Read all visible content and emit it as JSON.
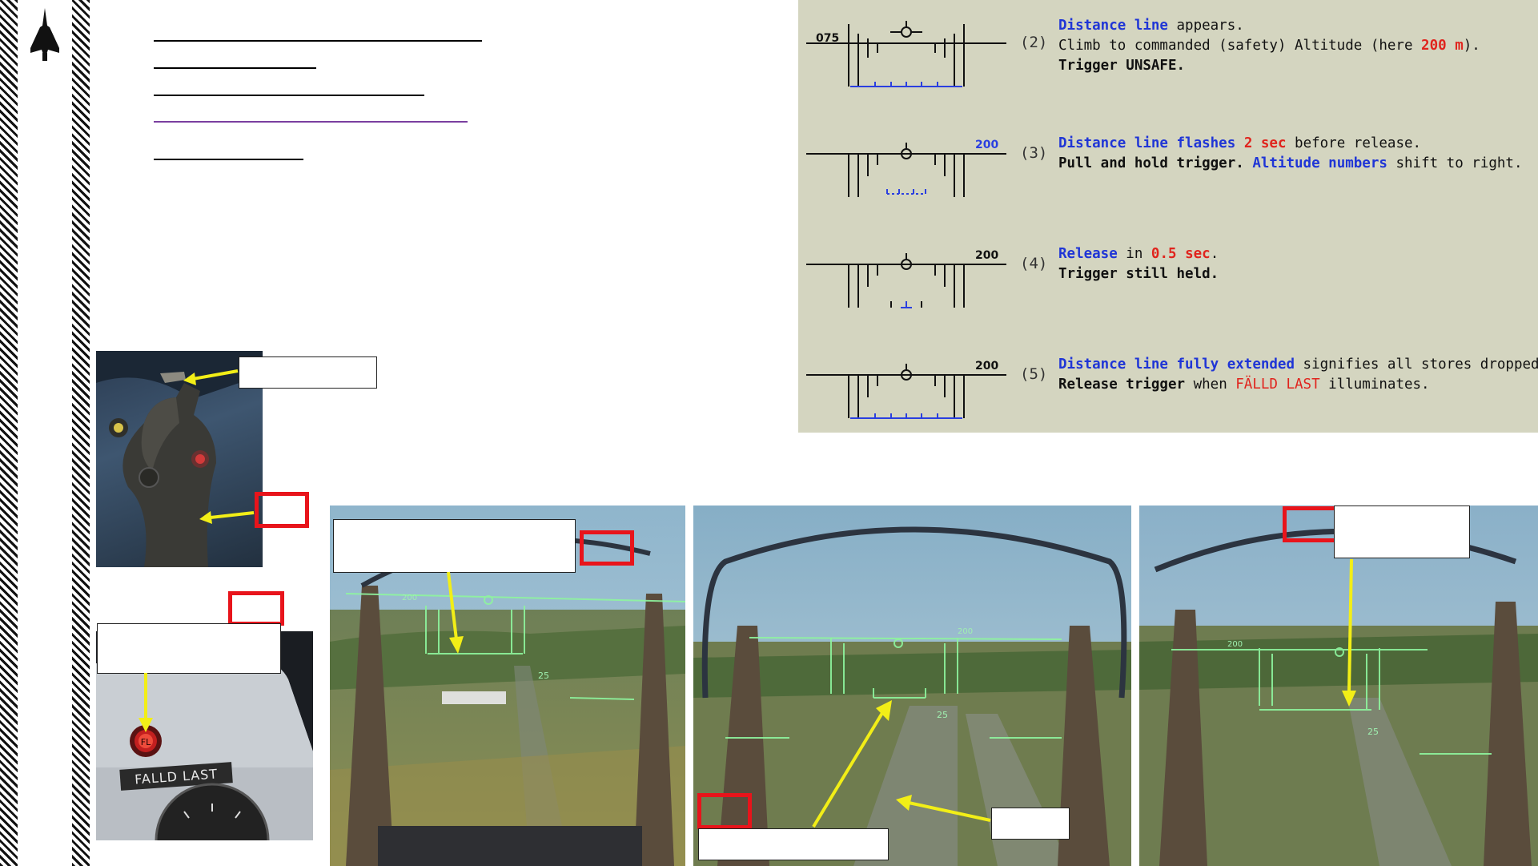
{
  "title_lines": [
    {
      "color": "#000000"
    },
    {
      "color": "#000000"
    },
    {
      "color": "#000000"
    },
    {
      "color": "#7a3fa0"
    },
    {
      "color": "#000000"
    }
  ],
  "sequence": {
    "steps": [
      {
        "number": "(2)",
        "altitude_label": "075",
        "line1": [
          {
            "t": "Distance line",
            "s": "blue"
          },
          {
            "t": " appears.",
            "s": ""
          }
        ],
        "line2": [
          {
            "t": "Climb to commanded (safety) Altitude (here ",
            "s": ""
          },
          {
            "t": "200 m",
            "s": "red"
          },
          {
            "t": ").",
            "s": ""
          }
        ],
        "line3": [
          {
            "t": "Trigger UNSAFE.",
            "s": "bold"
          }
        ]
      },
      {
        "number": "(3)",
        "altitude_label": "200",
        "line1": [
          {
            "t": "Distance line flashes",
            "s": "blue"
          },
          {
            "t": " ",
            "s": ""
          },
          {
            "t": "2 sec",
            "s": "red"
          },
          {
            "t": " before release.",
            "s": ""
          }
        ],
        "line2": [
          {
            "t": "Pull and hold trigger.",
            "s": "bold"
          },
          {
            "t": " ",
            "s": ""
          },
          {
            "t": "Altitude numbers",
            "s": "blue"
          },
          {
            "t": " shift to right.",
            "s": ""
          }
        ]
      },
      {
        "number": "(4)",
        "altitude_label": "200",
        "line1": [
          {
            "t": "Release",
            "s": "blue"
          },
          {
            "t": " in ",
            "s": ""
          },
          {
            "t": "0.5 sec",
            "s": "red"
          },
          {
            "t": ".",
            "s": ""
          }
        ],
        "line2": [
          {
            "t": "Trigger still held.",
            "s": "bold"
          }
        ]
      },
      {
        "number": "(5)",
        "altitude_label": "200",
        "line1": [
          {
            "t": "Distance line fully extended",
            "s": "blue"
          },
          {
            "t": " signifies all stores dropped.",
            "s": ""
          }
        ],
        "line2": [
          {
            "t": "Release trigger",
            "s": "bold"
          },
          {
            "t": " when ",
            "s": ""
          },
          {
            "t": "FÄLLD LAST",
            "s": "redtxt"
          },
          {
            "t": " illuminates.",
            "s": ""
          }
        ]
      }
    ]
  },
  "panel_lamp": {
    "lamp_text": "FL",
    "placard": "FALLD LAST"
  },
  "hud_views": {
    "view1": {
      "alt": "200",
      "runway": "25"
    },
    "view2": {
      "alt": "200",
      "runway": "25"
    },
    "view3": {
      "alt": "200",
      "runway": "25"
    }
  },
  "colors": {
    "panel_bg": "#d4d5c0",
    "accent_blue": "#1f35d6",
    "accent_red": "#e0241d",
    "callout_arrow": "#f2ee17",
    "callout_box": "#e8141b",
    "hud_green": "#8ef59e"
  }
}
